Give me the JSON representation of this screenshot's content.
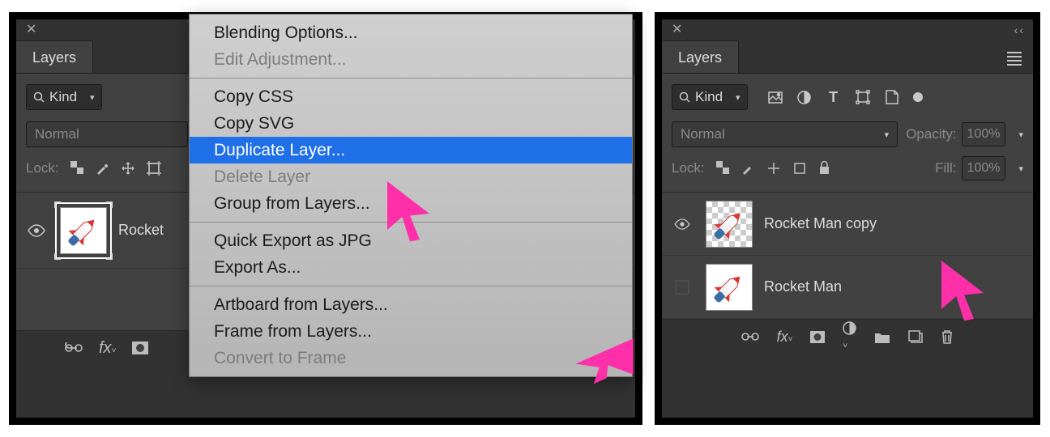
{
  "left_panel": {
    "title": "Layers",
    "filter_label": "Kind",
    "blend_mode": "Normal",
    "lock_label": "Lock:",
    "layers": [
      {
        "name": "Rocket"
      }
    ]
  },
  "right_panel": {
    "title": "Layers",
    "filter_label": "Kind",
    "blend_mode": "Normal",
    "opacity_label": "Opacity:",
    "opacity_value": "100%",
    "lock_label": "Lock:",
    "fill_label": "Fill:",
    "fill_value": "100%",
    "layers": [
      {
        "name": "Rocket Man copy",
        "visible": true,
        "transparent_bg": true
      },
      {
        "name": "Rocket Man",
        "visible": false,
        "transparent_bg": false
      }
    ]
  },
  "context_menu": {
    "items": [
      {
        "label": "Blending Options...",
        "enabled": true
      },
      {
        "label": "Edit Adjustment...",
        "enabled": false
      },
      {
        "sep": true
      },
      {
        "label": "Copy CSS",
        "enabled": true
      },
      {
        "label": "Copy SVG",
        "enabled": true
      },
      {
        "label": "Duplicate Layer...",
        "enabled": true,
        "hover": true
      },
      {
        "label": "Delete Layer",
        "enabled": false
      },
      {
        "label": "Group from Layers...",
        "enabled": true
      },
      {
        "sep": true
      },
      {
        "label": "Quick Export as JPG",
        "enabled": true
      },
      {
        "label": "Export As...",
        "enabled": true
      },
      {
        "sep": true
      },
      {
        "label": "Artboard from Layers...",
        "enabled": true
      },
      {
        "label": "Frame from Layers...",
        "enabled": true
      },
      {
        "label": "Convert to Frame",
        "enabled": false
      }
    ]
  },
  "icons": {
    "search": "search-icon",
    "image": "image-icon",
    "adjust": "adjustment-icon",
    "text": "text-icon",
    "shape": "shape-icon",
    "smart": "smartobject-icon"
  }
}
